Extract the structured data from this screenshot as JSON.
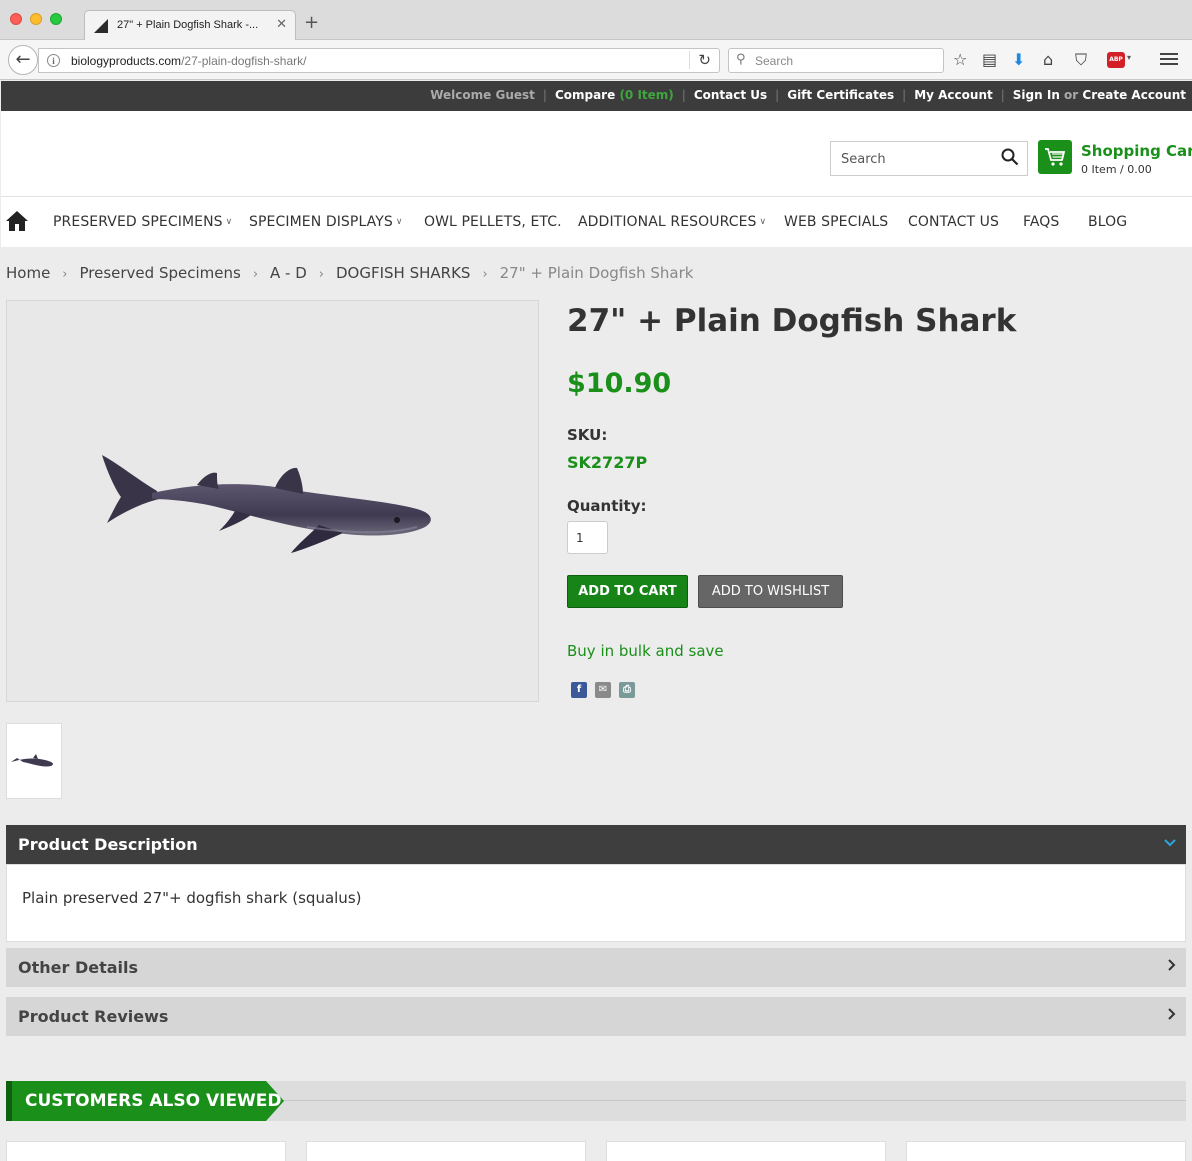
{
  "browser": {
    "tab_title": "27\" + Plain Dogfish Shark -...",
    "tab_close": "✕",
    "new_tab": "+",
    "url_domain": "biologyproducts.com",
    "url_path": "/27-plain-dogfish-shark/",
    "search_placeholder": "Search",
    "abp_label": "ABP"
  },
  "topbar": {
    "welcome": "Welcome Guest",
    "compare": "Compare",
    "compare_count": "(0 Item)",
    "contact": "Contact Us",
    "gift": "Gift Certificates",
    "account": "My Account",
    "sign_in": "Sign In",
    "or": "or",
    "create": "Create Account"
  },
  "header": {
    "search_placeholder": "Search",
    "cart_title": "Shopping Cart",
    "cart_summary": "0 Item / 0.00"
  },
  "nav": {
    "items": [
      {
        "label": "PRESERVED SPECIMENS",
        "dropdown": true
      },
      {
        "label": "SPECIMEN DISPLAYS",
        "dropdown": true
      },
      {
        "label": "OWL PELLETS, ETC.",
        "dropdown": false
      },
      {
        "label": "ADDITIONAL RESOURCES",
        "dropdown": true
      },
      {
        "label": "WEB SPECIALS",
        "dropdown": false
      },
      {
        "label": "CONTACT US",
        "dropdown": false
      },
      {
        "label": "FAQS",
        "dropdown": false
      },
      {
        "label": "BLOG",
        "dropdown": false
      }
    ]
  },
  "breadcrumb": {
    "items": [
      "Home",
      "Preserved Specimens",
      "A - D",
      "DOGFISH SHARKS"
    ],
    "current": "27\" + Plain Dogfish Shark",
    "separator": "›"
  },
  "product": {
    "title": "27\" + Plain Dogfish Shark",
    "price": "$10.90",
    "sku_label": "SKU:",
    "sku": "SK2727P",
    "qty_label": "Quantity:",
    "qty_value": "1",
    "add_to_cart": "ADD TO CART",
    "add_to_wishlist": "ADD TO WISHLIST",
    "bulk_link": "Buy in bulk and save"
  },
  "accordions": {
    "description_title": "Product Description",
    "description_text": "Plain preserved 27\"+ dogfish shark (squalus)",
    "other_title": "Other Details",
    "reviews_title": "Product Reviews"
  },
  "also_viewed": {
    "title": "CUSTOMERS ALSO VIEWED"
  },
  "colors": {
    "brand_green": "#1a8f1a",
    "topbar_bg": "#3c3c3c",
    "accordion_dark": "#3e3e3e"
  }
}
